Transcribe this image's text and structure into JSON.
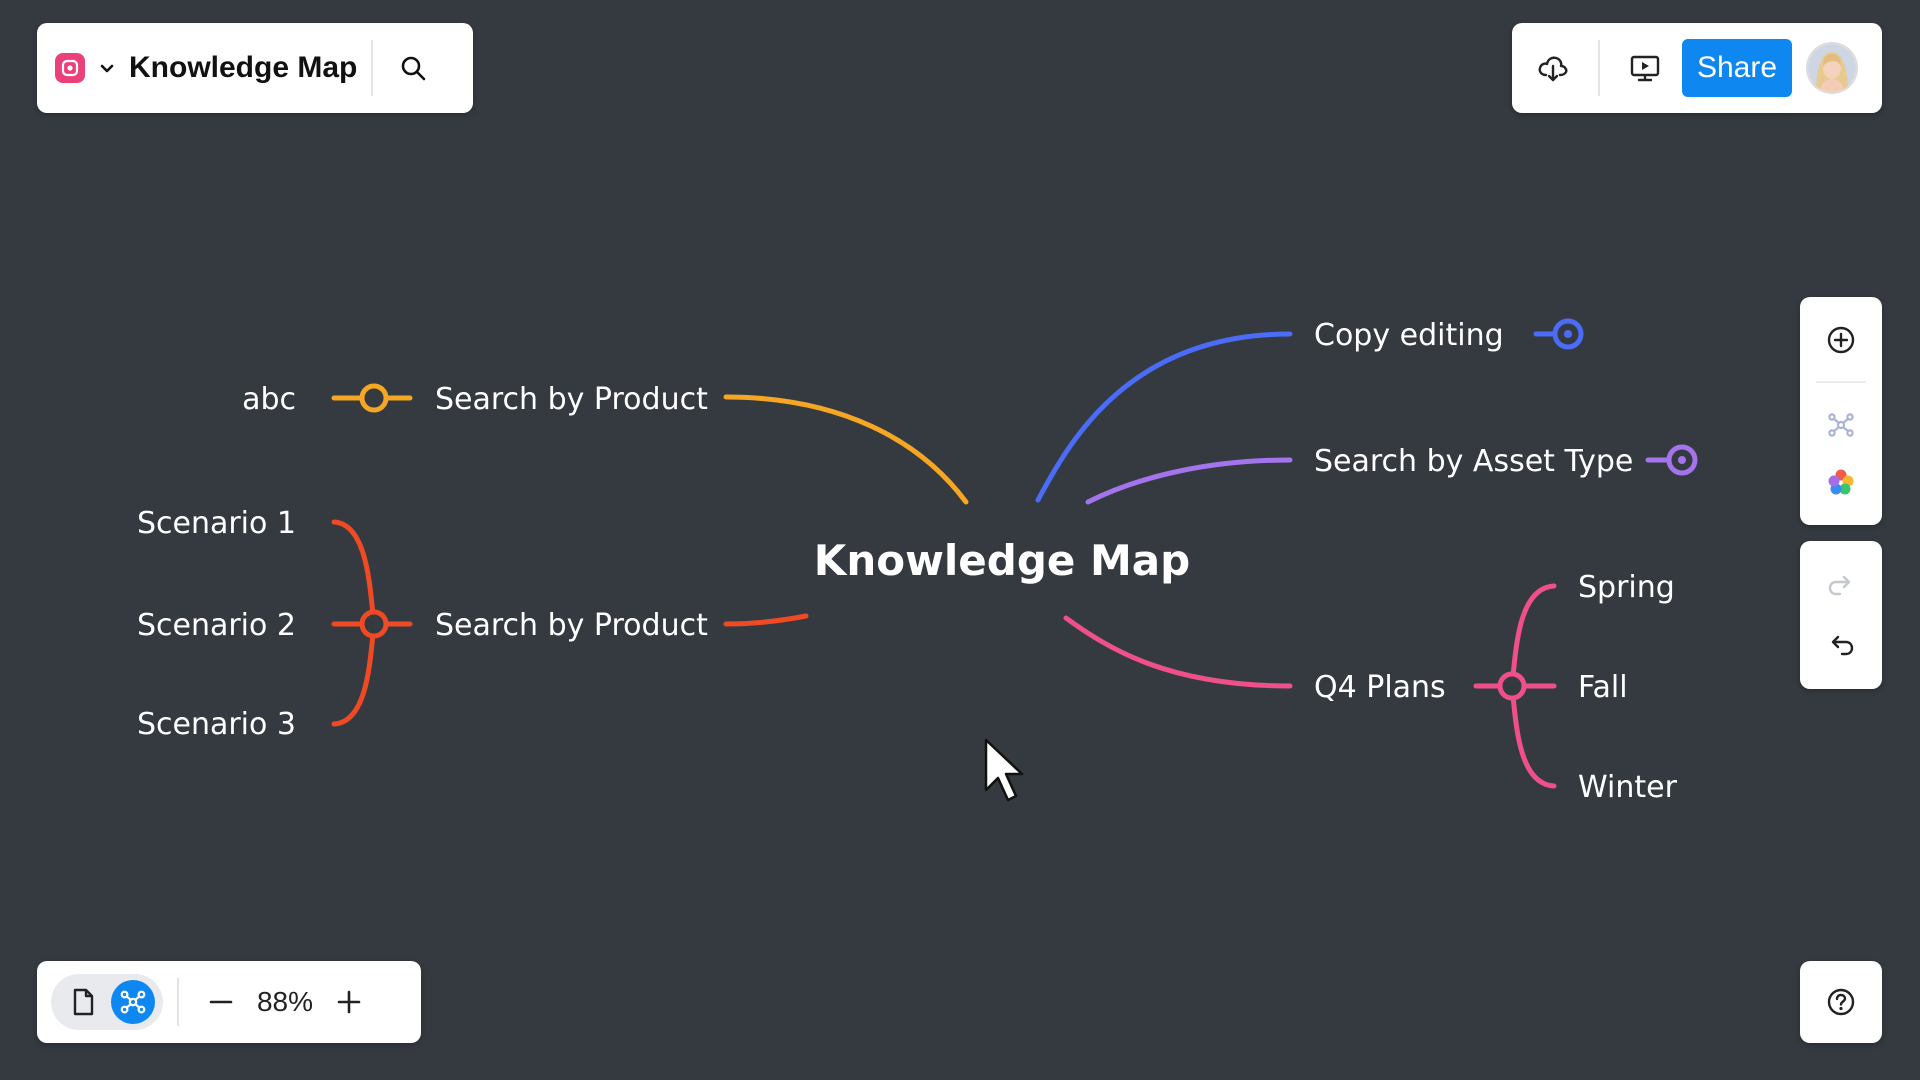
{
  "header": {
    "title": "Knowledge Map",
    "icons": {
      "logo": "app-logo-icon",
      "menu": "chevron-down-icon",
      "search": "search-icon"
    }
  },
  "toolbar": {
    "share_label": "Share",
    "icons": {
      "download": "cloud-download-icon",
      "present": "presentation-icon",
      "avatar": "avatar"
    },
    "accent": "#0e88f0"
  },
  "side_tools": {
    "icons": [
      "add-circle-icon",
      "node-layout-icon",
      "color-palette-icon",
      "redo-icon",
      "undo-icon"
    ]
  },
  "bottom_bar": {
    "zoom": "88%",
    "icons": [
      "page-view-icon",
      "mindmap-view-icon",
      "zoom-out-icon",
      "zoom-in-icon"
    ]
  },
  "mindmap": {
    "root": "Knowledge Map",
    "branches": [
      {
        "label": "Search by Product",
        "color": "#f5a623",
        "children": [
          "abc"
        ]
      },
      {
        "label": "Search by Product",
        "color": "#f04a24",
        "children": [
          "Scenario 1",
          "Scenario 2",
          "Scenario 3"
        ]
      },
      {
        "label": "Copy editing",
        "color": "#4a6cf7",
        "children": []
      },
      {
        "label": "Search by Asset Type",
        "color": "#a374ec",
        "children": []
      },
      {
        "label": "Q4 Plans",
        "color": "#f0508a",
        "children": [
          "Spring",
          "Fall",
          "Winter"
        ]
      }
    ]
  }
}
